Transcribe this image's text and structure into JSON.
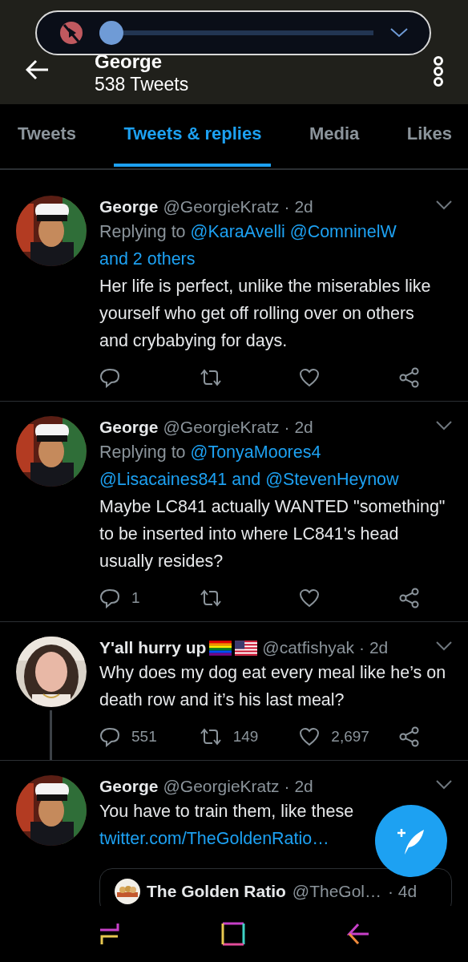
{
  "volume_overlay": {
    "muted": true,
    "level": 0.0
  },
  "header": {
    "title": "George",
    "subtitle": "538 Tweets"
  },
  "tabs": [
    {
      "label": "Tweets",
      "selected": false
    },
    {
      "label": "Tweets & replies",
      "selected": true
    },
    {
      "label": "Media",
      "selected": false
    },
    {
      "label": "Likes",
      "selected": false
    }
  ],
  "tweets": [
    {
      "name": "George",
      "handle": "@GeorgieKratz",
      "time": "· 2d",
      "thread_below": false,
      "replying_prefix": "Replying to",
      "mentions": [
        "@KaraAvelli",
        "@ComninelW",
        "and 2 others"
      ],
      "text": "Her life is perfect, unlike the miserables like yourself who get off rolling over on others and crybabying for days.",
      "actions": [
        {
          "kind": "reply"
        },
        {
          "kind": "retweet"
        },
        {
          "kind": "like"
        },
        {
          "kind": "share"
        }
      ]
    },
    {
      "name": "George",
      "handle": "@GeorgieKratz",
      "time": "· 2d",
      "thread_below": false,
      "replying_prefix": "Replying to",
      "mentions": [
        "@TonyaMoores4",
        "@Lisacaines841",
        "and @StevenHeynow"
      ],
      "text": "Maybe LC841 actually WANTED \"something\" to be inserted into where LC841's head usually resides?",
      "actions": [
        {
          "kind": "reply",
          "count": "1"
        },
        {
          "kind": "retweet"
        },
        {
          "kind": "like"
        },
        {
          "kind": "share"
        }
      ]
    },
    {
      "name": "Y'all hurry up",
      "name_badges": [
        {
          "kind": "rainbow-flag"
        },
        {
          "kind": "us-flag"
        }
      ],
      "handle": "@catfishyak",
      "time": "· 2d",
      "thread_below": true,
      "text": "Why does my dog eat every meal like he’s on death row and it’s his last meal?",
      "actions": [
        {
          "kind": "reply",
          "count": "551"
        },
        {
          "kind": "retweet",
          "count": "149"
        },
        {
          "kind": "like",
          "count": "2,697"
        },
        {
          "kind": "share"
        }
      ]
    },
    {
      "name": "George",
      "handle": "@GeorgieKratz",
      "time": "· 2d",
      "thread_below": false,
      "text": "You have to train them, like these",
      "link": "twitter.com/TheGoldenRatio…",
      "quote": {
        "name": "The Golden Ratio",
        "handle": "@TheGol…",
        "time": "· 4d"
      }
    }
  ]
}
